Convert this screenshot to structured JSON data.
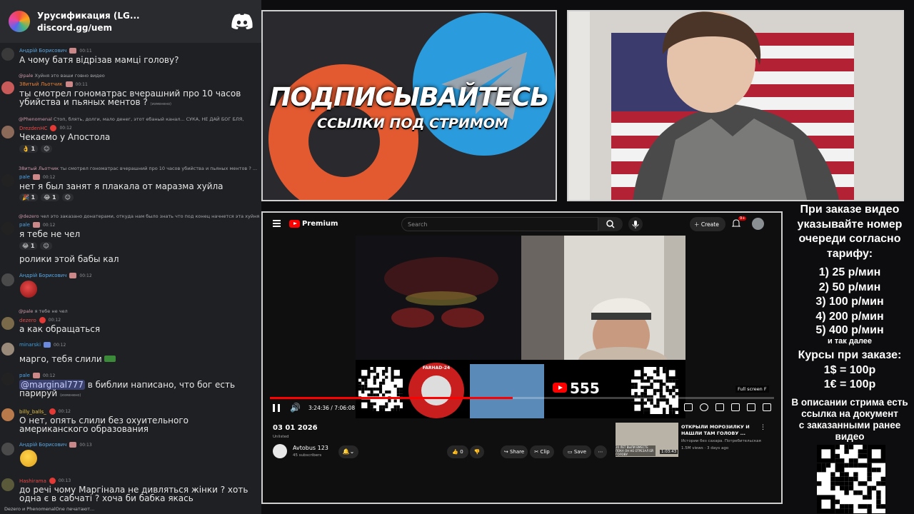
{
  "chat": {
    "server_name": "Урусификация (LG...",
    "invite": "discord.gg/uem",
    "messages": [
      {
        "user": "Андрій Борисович",
        "user_color": "#5aa9e6",
        "time": "00:11",
        "text": "А чому батя відрізав мамці голову?"
      },
      {
        "reply_user": "@pale",
        "reply_text": "Хуйня это ваши говно видео",
        "user": "38итый Льотчик",
        "user_color": "#e8833a",
        "time": "00:11",
        "text": "ты смотрел гономатрас вчерашний про 10 часов убийства и пьяных ментов ?",
        "edited": "(изменено)"
      },
      {
        "reply_user": "@Phenomenal",
        "reply_text": "Стоп, блять, долги, мало денег, этот ебаный канал...  СУКА, НЕ ДАЙ БОГ БЛЯ,",
        "user": "DrezdenHC",
        "user_color": "#e84a4a",
        "time": "00:12",
        "text": "Чекаємо у Апостола",
        "reactions": [
          "1",
          ""
        ]
      },
      {
        "reply_user": "38итый Льотчик",
        "reply_text": "ты смотрел гономатрас вчерашний про 10 часов убийства и пьяных ментов ? ...",
        "user": "pale",
        "user_color": "#4fa3e6",
        "time": "00:12",
        "text": "нет я был занят я плакала от маразма хуйла",
        "reactions": [
          "1",
          "1",
          ""
        ]
      },
      {
        "reply_user": "@dezero",
        "reply_text": "чел это заказано донатерами, откуда нам было знать что под конец начнется эта хуйня",
        "user": "pale",
        "user_color": "#4fa3e6",
        "time": "00:12",
        "text": "я тебе не чел",
        "reactions": [
          "1",
          ""
        ],
        "text2": "ролики этой бабы кал"
      },
      {
        "user": "Андрій Борисович",
        "user_color": "#5aa9e6",
        "time": "00:12"
      },
      {
        "reply_user": "@pale",
        "reply_text": "я тебе не чел",
        "user": "dezero",
        "user_color": "#e84a4a",
        "time": "00:12",
        "text": "а как обращаться"
      },
      {
        "user": "minarski",
        "user_color": "#3b9ee0",
        "time": "00:12",
        "text": "марго, тебя слили"
      },
      {
        "user": "pale",
        "user_color": "#4fa3e6",
        "time": "00:12",
        "mention": "@marginal777",
        "text": " в библии написано, что бог есть парируй",
        "edited": "(изменено)"
      },
      {
        "user": "billy_balls_",
        "user_color": "#e8c23a",
        "time": "00:12",
        "text": "О нет, опять слили без охуительного американского образования"
      },
      {
        "user": "Андрій Борисович",
        "user_color": "#5aa9e6",
        "time": "00:13"
      },
      {
        "user": "Hashirama",
        "user_color": "#e84a4a",
        "time": "00:13",
        "text": "до речі чому Маргінала не дивляться жінки ? хоть одна є в сабчаті ? хоча би бабка якась"
      }
    ],
    "typing": "Dezero и PhenomenalOne печатают..."
  },
  "promo": {
    "title": "ПОДПИСЫВАЙТЕСЬ",
    "subtitle": "ССЫЛКИ ПОД СТРИМОМ"
  },
  "youtube": {
    "logo_label": "Premium",
    "search_placeholder": "Search",
    "create_label": "Create",
    "bell_count": "9+",
    "time_display": "3:24:36 / 7:06:08",
    "progress": 0.4817,
    "fullscreen_tip": "Full screen  F",
    "banner_count": "555",
    "banner_badge": "FARHAD-24",
    "video_title": "03 01 2026",
    "status": "Unlisted",
    "channel_name": "Avtobus 123",
    "channel_subs": "45 subscribers",
    "like_count": "0",
    "share_label": "Share",
    "clip_label": "Clip",
    "save_label": "Save",
    "related": {
      "title": "ОТКРЫЛИ МОРОЗИЛКУ И НАШЛИ ТАМ ГОЛОВУ ...",
      "channel": "Истории без сахара. Потребительская...",
      "views": "1.5M views · 3 days ago",
      "duration": "1:03:43",
      "thumb_caption": "20 ЛЕТ ВЫЛИ ВМЕСТЕ ПОКА ОН НЕ ОТРЕЗАЛ ЕЙ ГОЛОВУ"
    }
  },
  "info": {
    "lines": [
      "При заказе видео",
      "указывайте номер",
      "очереди согласно",
      "тарифу:"
    ],
    "tariffs": [
      "1) 25 р/мин",
      "2) 50 р/мин",
      "3) 100 р/мин",
      "4) 200 р/мин",
      "5) 400 р/мин"
    ],
    "etc": "и так далее",
    "courses_title": "Курсы при заказе:",
    "usd": "1$ = 100р",
    "eur": "1€ = 100р",
    "desc": [
      "В описании стрима есть",
      "ссылка на документ",
      "с заказанными ранее",
      "видео"
    ]
  }
}
